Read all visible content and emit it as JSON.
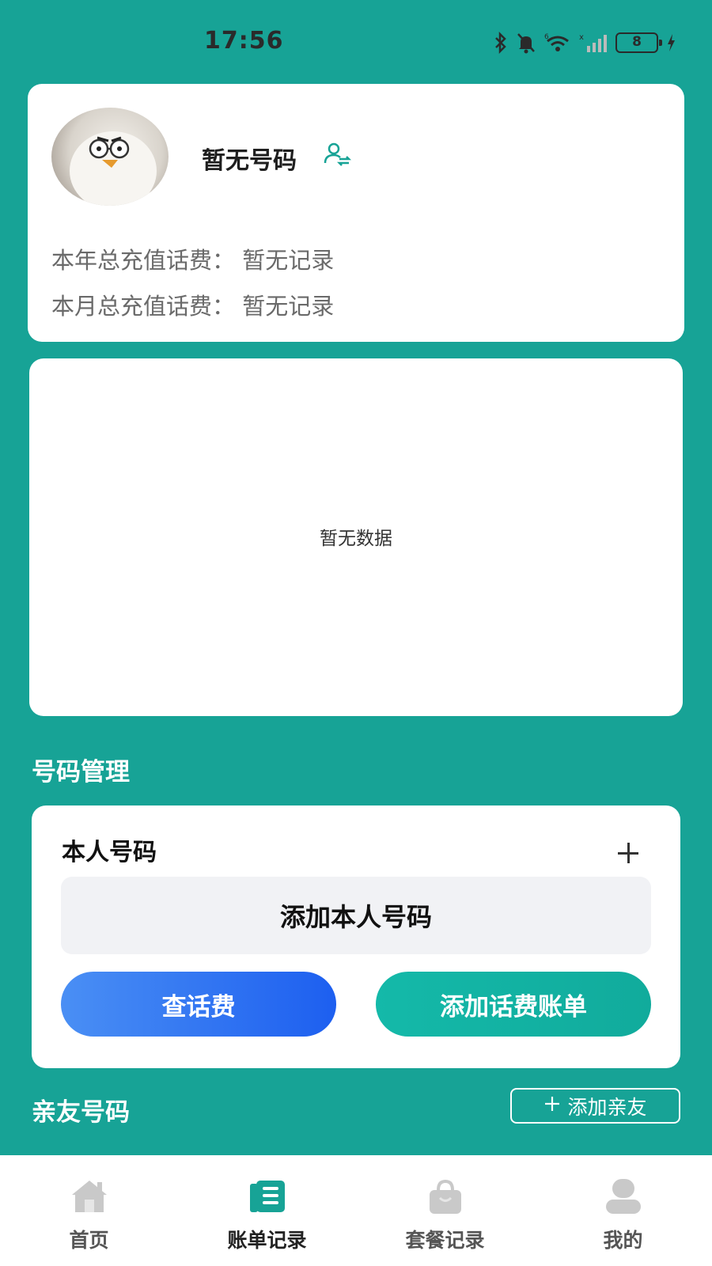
{
  "status_bar": {
    "time": "17:56",
    "battery": "8"
  },
  "profile": {
    "phone": "暂无号码",
    "year_total": "本年总充值话费：  暂无记录",
    "month_total": "本月总充值话费：  暂无记录"
  },
  "chart_area": {
    "empty_text": "暂无数据"
  },
  "number_management": {
    "title": "号码管理",
    "self_number_title": "本人号码",
    "add_self_label": "添加本人号码",
    "query_fee_label": "查话费",
    "add_bill_label": "添加话费账单"
  },
  "friends": {
    "title": "亲友号码",
    "add_friend_label": "添加亲友"
  },
  "bottom_nav": {
    "items": [
      {
        "label": "首页",
        "icon": "home-icon"
      },
      {
        "label": "账单记录",
        "icon": "bill-icon"
      },
      {
        "label": "套餐记录",
        "icon": "bag-icon"
      },
      {
        "label": "我的",
        "icon": "user-icon"
      }
    ],
    "active_index": 1,
    "accent_color": "#17a396"
  },
  "colors": {
    "background": "#17a396",
    "query_button": "#2d6ff2",
    "bill_button": "#12b2a3"
  }
}
